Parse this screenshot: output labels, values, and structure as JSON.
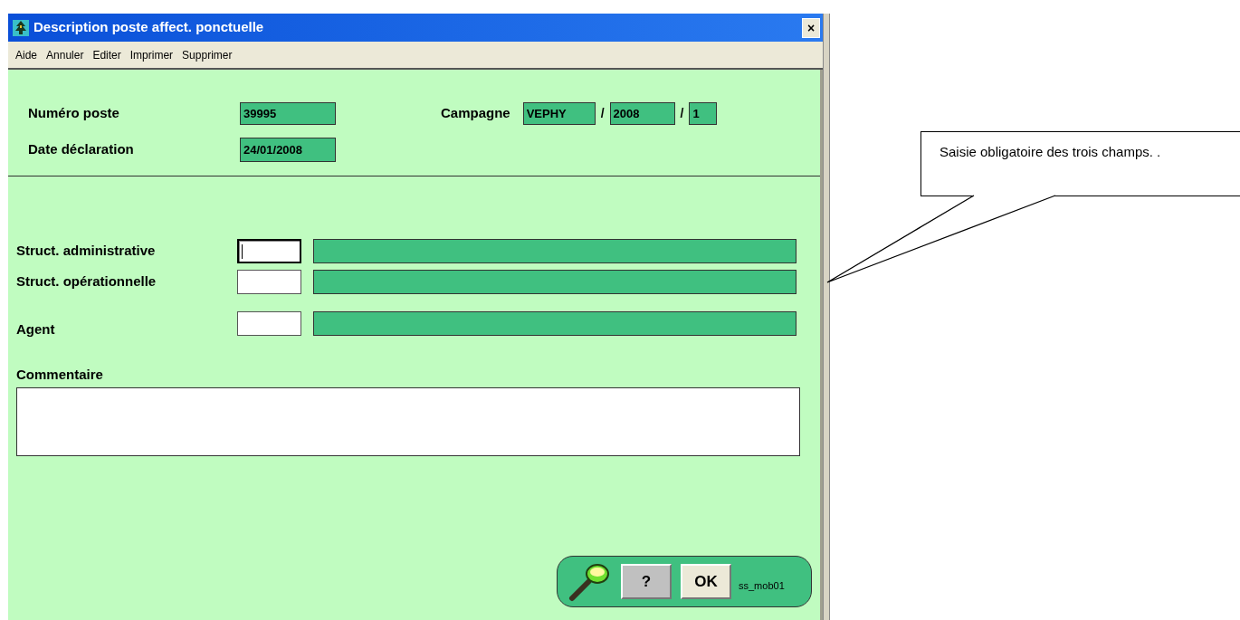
{
  "window": {
    "title": "Description poste affect. ponctuelle",
    "close": "×"
  },
  "menu": [
    "Aide",
    "Annuler",
    "Editer",
    "Imprimer",
    "Supprimer"
  ],
  "header": {
    "numero": {
      "label": "Numéro poste",
      "value": "39995"
    },
    "date": {
      "label": "Date déclaration",
      "value": "24/01/2008"
    },
    "campagne": {
      "label": "Campagne",
      "parts": [
        "VEPHY",
        "2008",
        "1"
      ],
      "separator": "/"
    }
  },
  "structures": [
    {
      "label": "Struct. administrative",
      "focused": true
    },
    {
      "label": "Struct. opérationnelle",
      "focused": false
    },
    {
      "label": "Agent",
      "focused": false
    }
  ],
  "comment": {
    "label": "Commentaire"
  },
  "toolbar": {
    "buttons": [
      {
        "kind": "help",
        "label": "?"
      },
      {
        "kind": "ok",
        "label": "OK"
      }
    ],
    "code": "ss_mob01"
  },
  "callout": {
    "text": "Saisie obligatoire des trois champs. ."
  }
}
